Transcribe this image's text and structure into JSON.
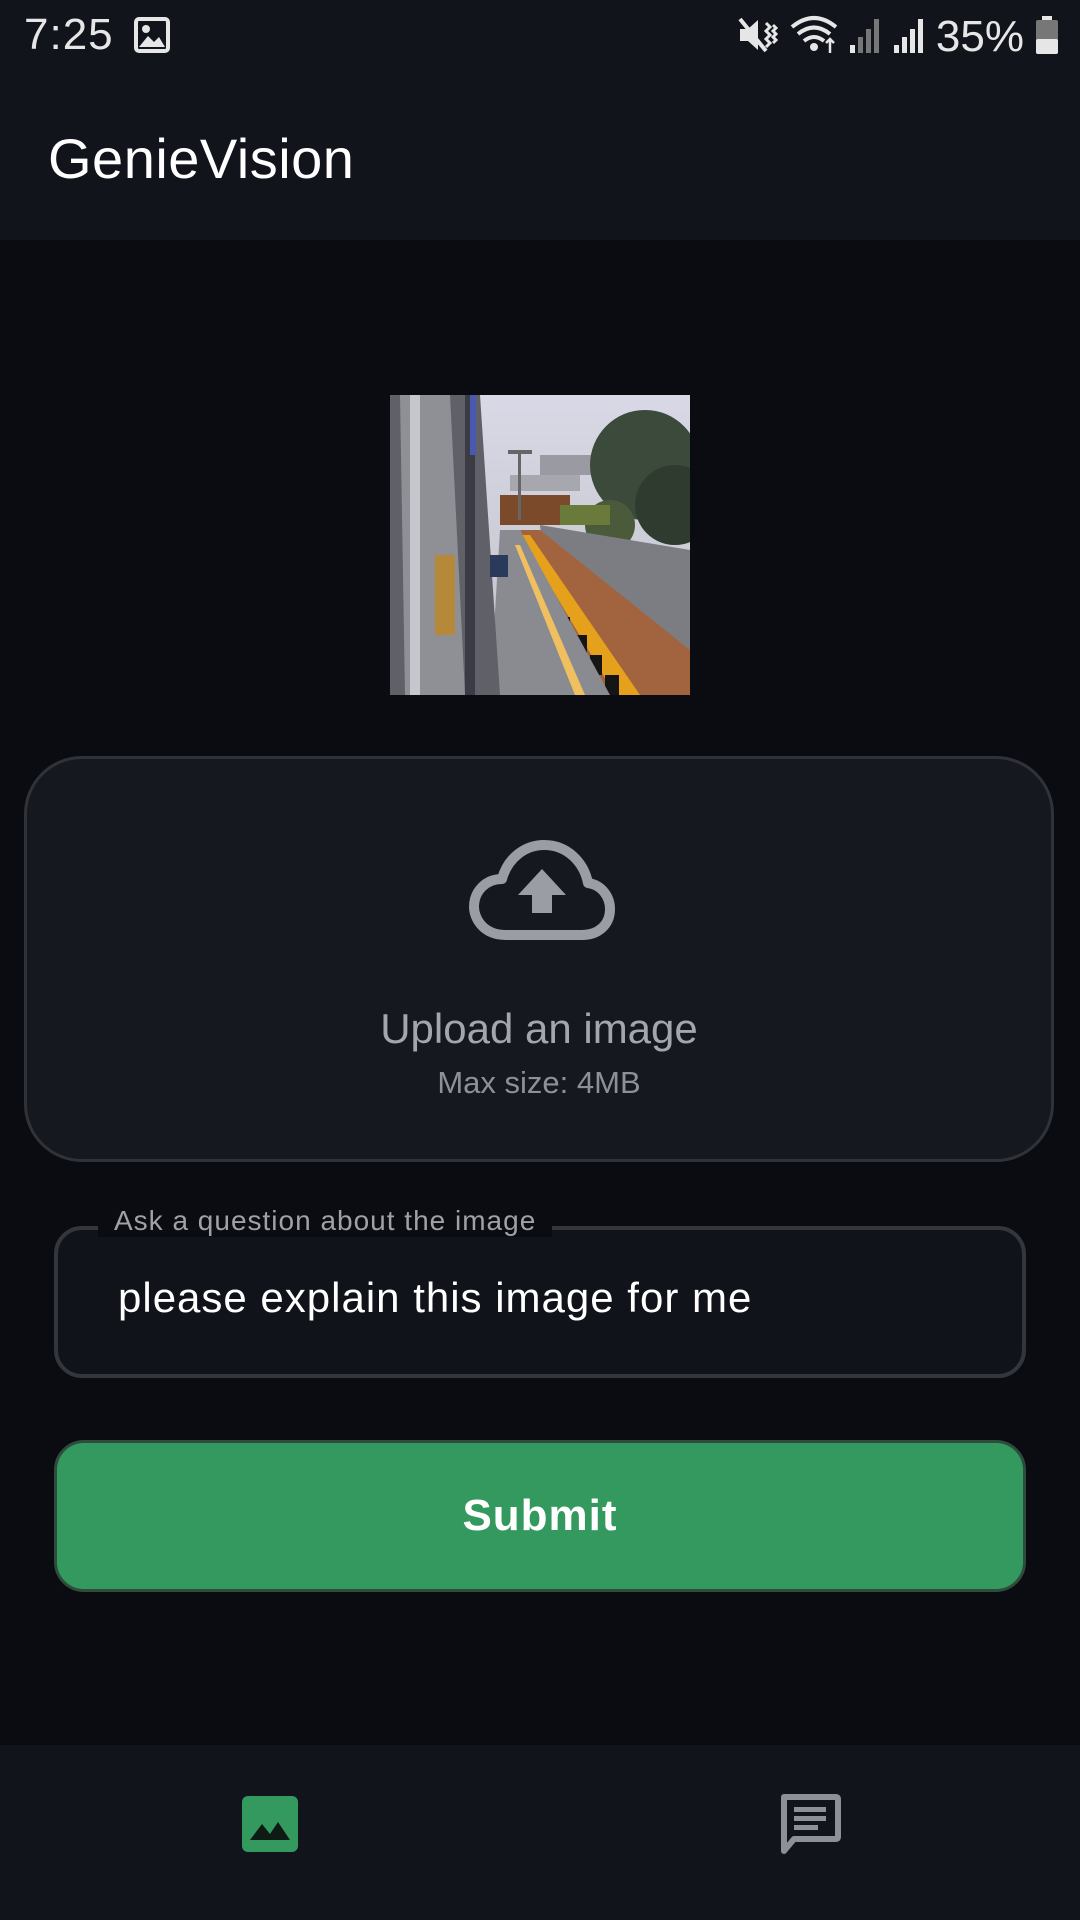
{
  "status_bar": {
    "time": "7:25",
    "battery_percent": "35%",
    "icons": [
      "gallery-icon",
      "mute-vibrate-icon",
      "wifi-icon",
      "signal-icon",
      "signal-icon",
      "battery-icon"
    ]
  },
  "app_bar": {
    "title": "GenieVision"
  },
  "upload": {
    "title": "Upload an image",
    "subtitle": "Max size: 4MB",
    "icon": "cloud-upload-icon"
  },
  "question": {
    "label": "Ask a question about the image",
    "value": "please explain this image for me"
  },
  "submit": {
    "label": "Submit"
  },
  "bottom_nav": {
    "items": [
      {
        "icon": "image-icon",
        "active": true
      },
      {
        "icon": "chat-icon",
        "active": false
      }
    ]
  },
  "colors": {
    "accent": "#34995e",
    "background": "#0b0c11",
    "surface": "#12141b"
  }
}
